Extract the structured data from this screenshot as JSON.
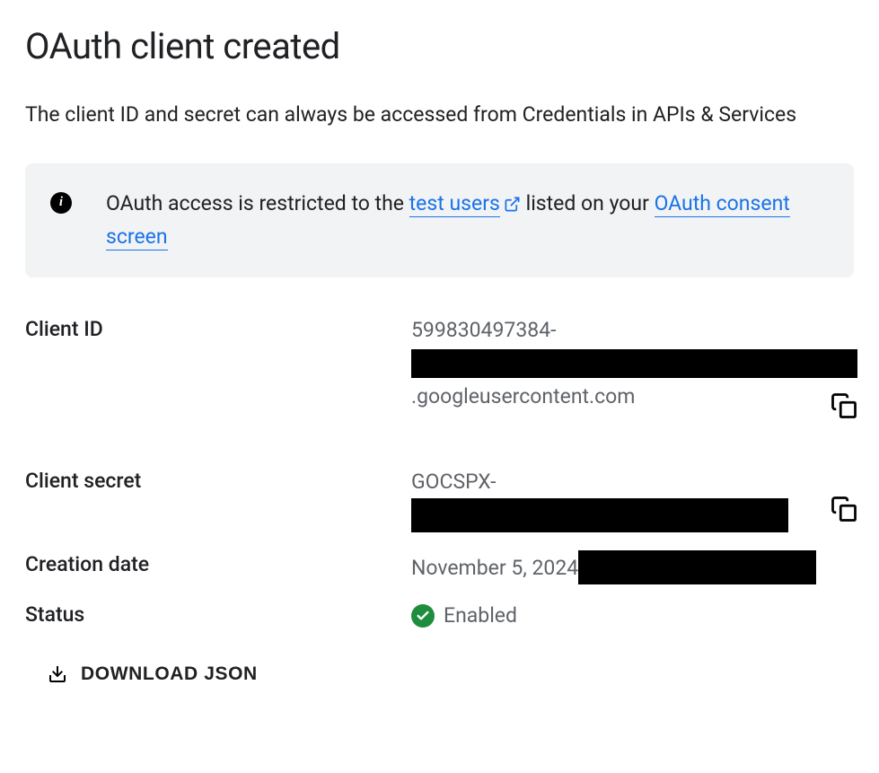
{
  "title": "OAuth client created",
  "subtitle": "The client ID and secret can always be accessed from Credentials in APIs & Services",
  "banner": {
    "pre": "OAuth access is restricted to the ",
    "link1": "test users",
    "mid": " listed on your ",
    "link2": "OAuth consent screen"
  },
  "fields": {
    "client_id": {
      "label": "Client ID",
      "prefix": "599830497384-",
      "suffix": ".googleusercontent.com"
    },
    "client_secret": {
      "label": "Client secret",
      "prefix": "GOCSPX-"
    },
    "creation_date": {
      "label": "Creation date",
      "value": "November 5, 2024"
    },
    "status": {
      "label": "Status",
      "value": "Enabled"
    }
  },
  "download_label": "DOWNLOAD JSON"
}
